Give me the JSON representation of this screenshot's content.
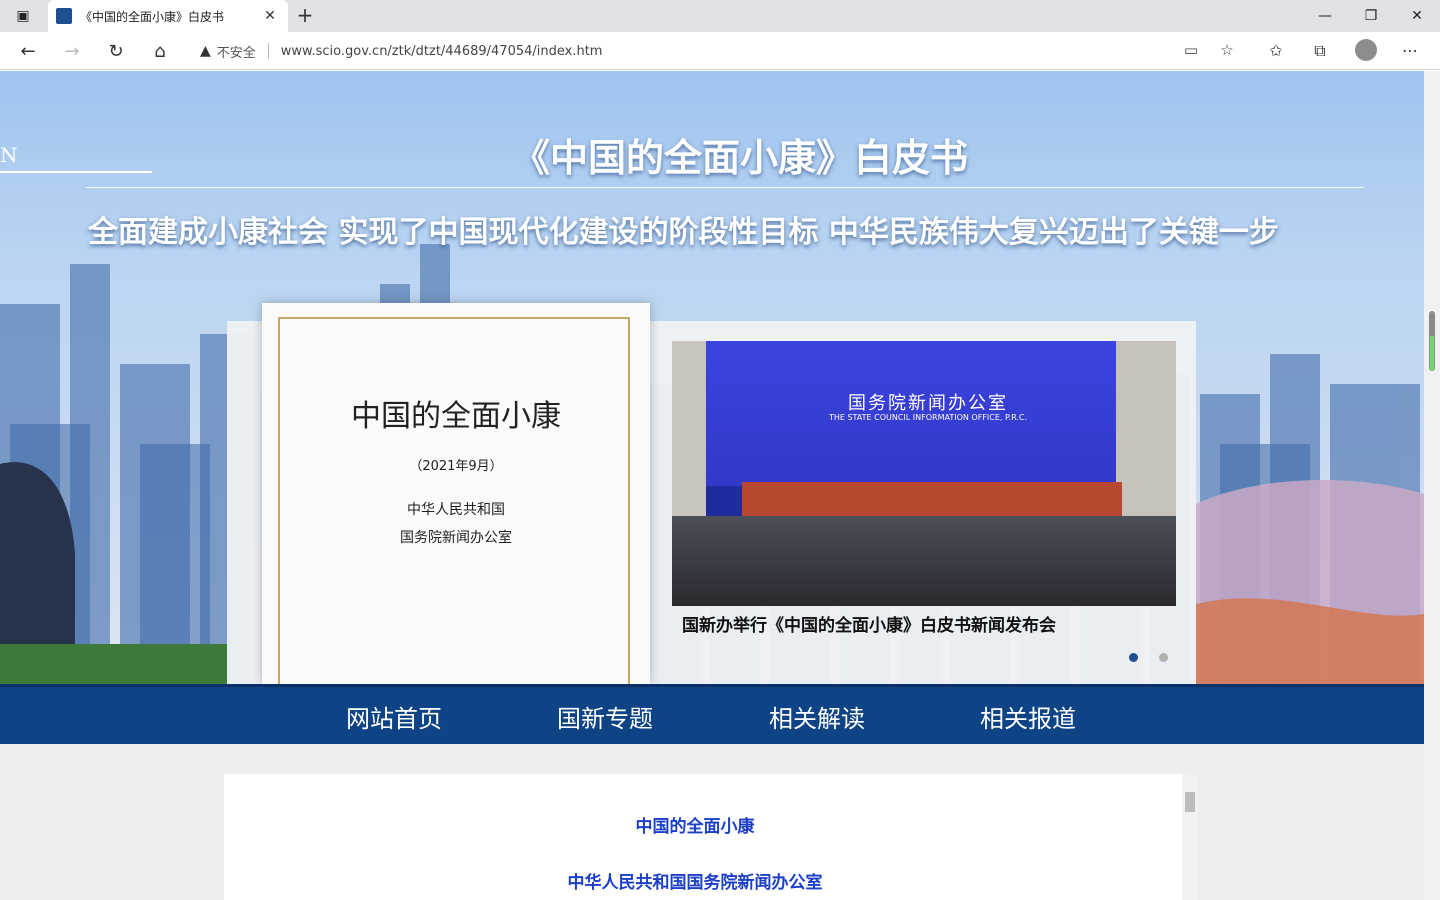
{
  "browser": {
    "tab_title": "《中国的全面小康》白皮书",
    "tab_close": "✕",
    "new_tab": "+",
    "security_label": "不安全",
    "url": "www.scio.gov.cn/ztk/dtzt/44689/47054/index.htm",
    "window": {
      "minimize": "—",
      "restore": "❐",
      "close": "✕"
    }
  },
  "hero": {
    "title": "《中国的全面小康》白皮书",
    "subtitle": "全面建成小康社会 实现了中国现代化建设的阶段性目标 中华民族伟大复兴迈出了关键一步",
    "left_letter": "N"
  },
  "book": {
    "title": "中国的全面小康",
    "date": "（2021年9月）",
    "author_line1": "中华人民共和国",
    "author_line2": "国务院新闻办公室"
  },
  "slide": {
    "photo_title": "国务院新闻办公室",
    "photo_subtitle": "THE STATE COUNCIL INFORMATION OFFICE, P.R.C.",
    "caption": "国新办举行《中国的全面小康》白皮书新闻发布会",
    "active_dot_color": "#1d4e8f",
    "inactive_dot_color": "#b0b0b0"
  },
  "nav": {
    "items": [
      "网站首页",
      "国新专题",
      "相关解读",
      "相关报道"
    ],
    "background": "#0e4486"
  },
  "content": {
    "line1": "中国的全面小康",
    "line2": "中华人民共和国国务院新闻办公室",
    "link_color": "#1b3fc9"
  }
}
